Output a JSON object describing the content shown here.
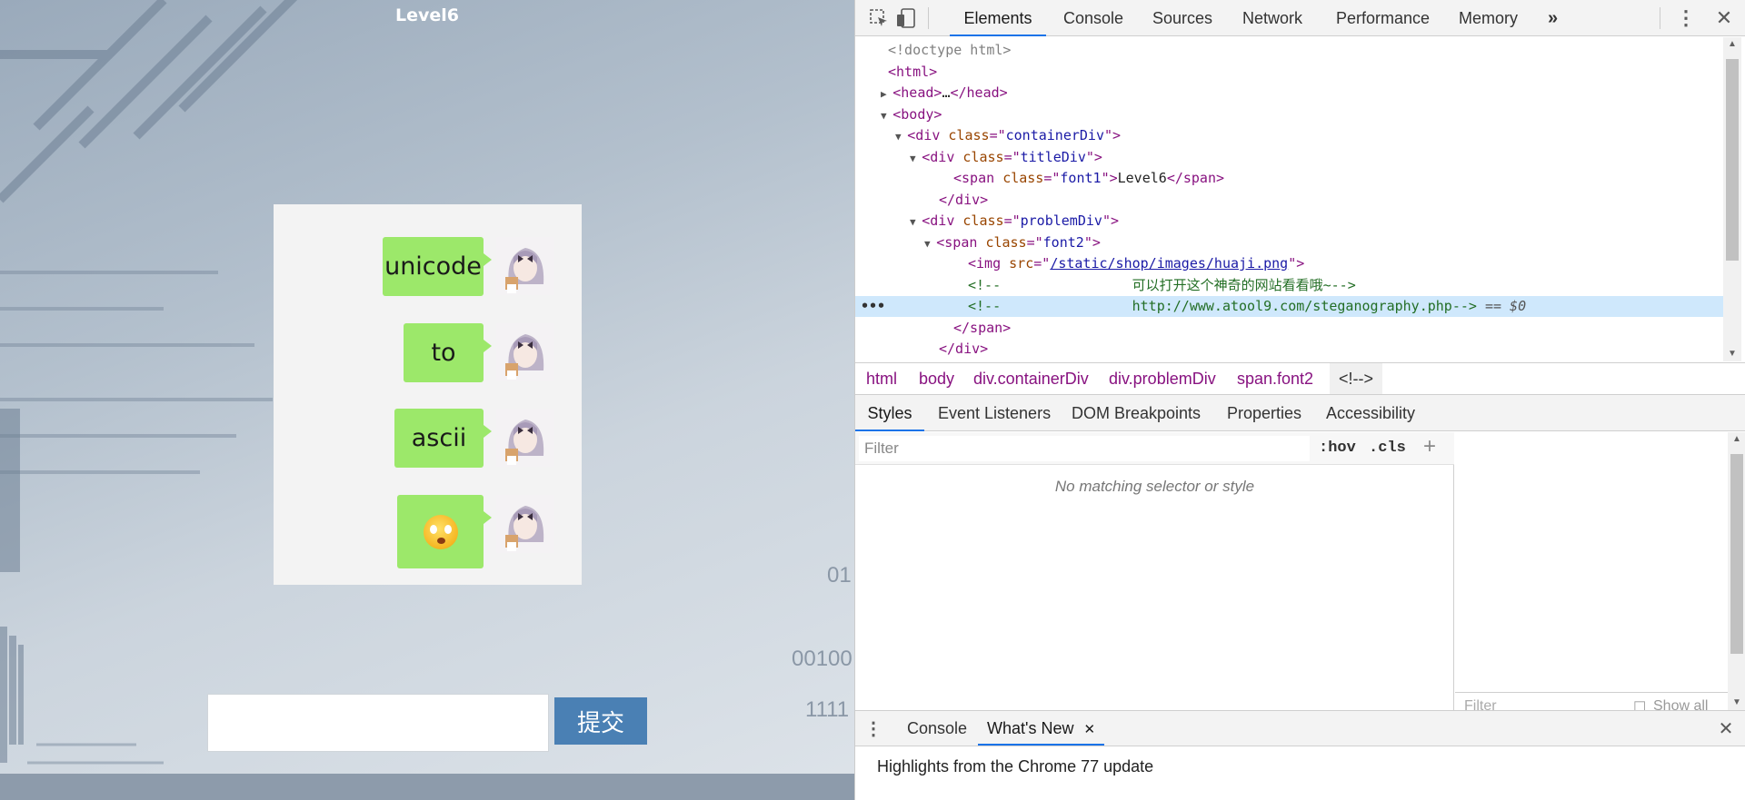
{
  "page": {
    "title": "Level6",
    "chat": [
      {
        "text": "unicode",
        "type": "text"
      },
      {
        "text": "to",
        "type": "text"
      },
      {
        "text": "ascii",
        "type": "text"
      },
      {
        "text": "",
        "type": "emoji",
        "icon": "smiling-face-emoji"
      }
    ],
    "answer_placeholder": "",
    "submit_label": "提交",
    "bg_digits": [
      "01",
      "00100",
      "1111"
    ],
    "colors": {
      "bubble": "#9ce86a",
      "submit": "#4a80b4",
      "chat_bg": "#f3f3f3"
    }
  },
  "devtools": {
    "tabs": [
      "Elements",
      "Console",
      "Sources",
      "Network",
      "Performance",
      "Memory"
    ],
    "more_tabs_icon": "»",
    "active_tab": "Elements",
    "dom_lines": [
      {
        "parts": [
          {
            "t": "gray",
            "v": "<!doctype html>"
          }
        ]
      },
      {
        "parts": [
          {
            "t": "tag",
            "v": "<html>"
          }
        ]
      },
      {
        "tri": "▶",
        "parts": [
          {
            "t": "tag",
            "v": "<head>"
          },
          {
            "t": "text",
            "v": "…"
          },
          {
            "t": "tag",
            "v": "</head>"
          }
        ]
      },
      {
        "tri": "▼",
        "parts": [
          {
            "t": "tag",
            "v": "<body>"
          }
        ]
      },
      {
        "tri": "▼",
        "parts": [
          {
            "t": "tag",
            "v": "<div "
          },
          {
            "t": "attr",
            "v": "class"
          },
          {
            "t": "tag",
            "v": "=\""
          },
          {
            "t": "val",
            "v": "containerDiv"
          },
          {
            "t": "tag",
            "v": "\">"
          }
        ]
      },
      {
        "tri": "▼",
        "parts": [
          {
            "t": "tag",
            "v": "<div "
          },
          {
            "t": "attr",
            "v": "class"
          },
          {
            "t": "tag",
            "v": "=\""
          },
          {
            "t": "val",
            "v": "titleDiv"
          },
          {
            "t": "tag",
            "v": "\">"
          }
        ]
      },
      {
        "parts": [
          {
            "t": "tag",
            "v": "<span "
          },
          {
            "t": "attr",
            "v": "class"
          },
          {
            "t": "tag",
            "v": "=\""
          },
          {
            "t": "val",
            "v": "font1"
          },
          {
            "t": "tag",
            "v": "\">"
          },
          {
            "t": "text",
            "v": "Level6"
          },
          {
            "t": "tag",
            "v": "</span>"
          }
        ]
      },
      {
        "parts": [
          {
            "t": "tag",
            "v": "</div>"
          }
        ]
      },
      {
        "tri": "▼",
        "parts": [
          {
            "t": "tag",
            "v": "<div "
          },
          {
            "t": "attr",
            "v": "class"
          },
          {
            "t": "tag",
            "v": "=\""
          },
          {
            "t": "val",
            "v": "problemDiv"
          },
          {
            "t": "tag",
            "v": "\">"
          }
        ]
      },
      {
        "tri": "▼",
        "parts": [
          {
            "t": "tag",
            "v": "<span "
          },
          {
            "t": "attr",
            "v": "class"
          },
          {
            "t": "tag",
            "v": "=\""
          },
          {
            "t": "val",
            "v": "font2"
          },
          {
            "t": "tag",
            "v": "\">"
          }
        ]
      },
      {
        "parts": [
          {
            "t": "tag",
            "v": "<img "
          },
          {
            "t": "attr",
            "v": "src"
          },
          {
            "t": "tag",
            "v": "=\""
          },
          {
            "t": "link",
            "v": "/static/shop/images/huaji.png"
          },
          {
            "t": "tag",
            "v": "\">"
          }
        ]
      },
      {
        "parts": [
          {
            "t": "comment",
            "v": "<!--                可以打开这个神奇的网站看看哦~-->"
          }
        ]
      },
      {
        "selected": true,
        "parts": [
          {
            "t": "comment",
            "v": "<!--                http://www.atool9.com/steganography.php-->"
          },
          {
            "t": "dollar",
            "v": " == $0"
          }
        ]
      },
      {
        "parts": [
          {
            "t": "tag",
            "v": "</span>"
          }
        ]
      },
      {
        "parts": [
          {
            "t": "tag",
            "v": "</div>"
          }
        ]
      }
    ],
    "breadcrumbs": [
      "html",
      "body",
      "div.containerDiv",
      "div.problemDiv",
      "span.font2",
      "<!-->"
    ],
    "sub_tabs": [
      "Styles",
      "Event Listeners",
      "DOM Breakpoints",
      "Properties",
      "Accessibility"
    ],
    "filter_placeholder": "Filter",
    "hov_label": ":hov",
    "cls_label": ".cls",
    "no_match_text": "No matching selector or style",
    "computed_filter": "Filter",
    "show_all": "Show all",
    "drawer_tabs": [
      "Console",
      "What's New"
    ],
    "drawer_body": "Highlights from the Chrome 77 update"
  }
}
